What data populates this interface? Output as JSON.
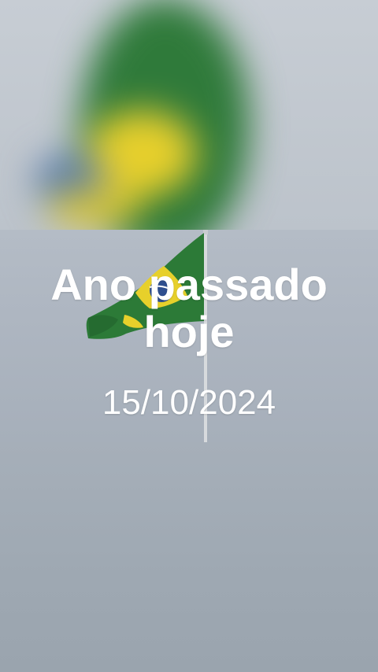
{
  "post": {
    "headline_line1": "Ano passado",
    "headline_line2": "hoje",
    "date": "15/10/2024"
  },
  "colors": {
    "flag_green": "#2c7a37",
    "flag_yellow": "#e7d02b",
    "flag_blue": "#2f4f8f",
    "sky": "#aeb6c1",
    "text": "#ffffff"
  },
  "icons": {
    "flag": "brazil-flag-icon"
  }
}
